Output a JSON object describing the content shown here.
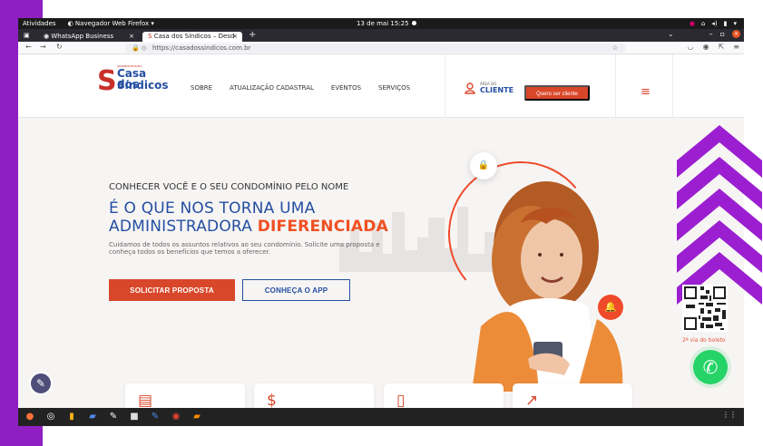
{
  "system": {
    "activities": "Atividades",
    "browser_name": "Navegador Web Firefox",
    "clock": "13 de mai 15:25"
  },
  "browser": {
    "tabs": [
      {
        "label": "WhatsApp Business",
        "close": "×"
      },
      {
        "label": "Casa dos Síndicos – Desd",
        "close": "×"
      }
    ],
    "new_tab": "+",
    "url": "https://casadossindicos.com.br"
  },
  "site": {
    "logo": {
      "top_text": "ADMINISTRADORA",
      "name_line1": "Casa dos",
      "name_line2": "Síndicos"
    },
    "menu": [
      "SOBRE",
      "ATUALIZAÇÃO CADASTRAL",
      "EVENTOS",
      "SERVIÇOS"
    ],
    "client_area": {
      "small": "ÁREA DO",
      "big": "CLIENTE"
    },
    "cta_label": "Quero ser cliente",
    "hero": {
      "subtitle": "CONHECER VOCÊ E O SEU CONDOMÍNIO PELO NOME",
      "title_line1": "É O QUE NOS TORNA UMA",
      "title_line2_prefix": "ADMINISTRADORA",
      "title_line2_accent": "DIFERENCIADA",
      "description": "Cuidamos de todos os assuntos relativos ao seu condomínio. Solicite uma proposta e conheça todos os benefícios que temos a oferecer.",
      "primary_button": "SOLICITAR PROPOSTA",
      "secondary_button": "CONHEÇA O APP"
    },
    "side_label": "2ª via do boleto"
  },
  "colors": {
    "purple": "#8f1fc2",
    "blue": "#244ea1",
    "orange": "#d9472a",
    "whatsapp": "#25d366"
  }
}
